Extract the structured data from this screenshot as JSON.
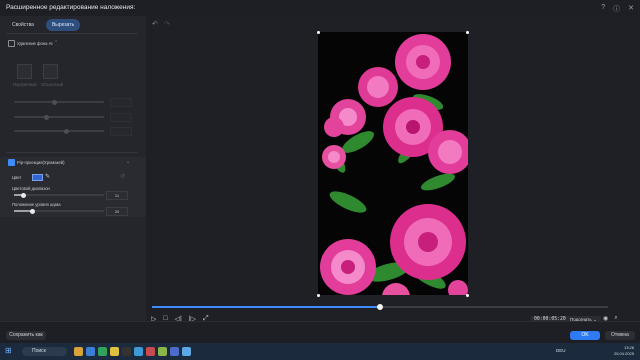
{
  "window": {
    "title": "Расширенное редактирование наложения:"
  },
  "tabs": [
    {
      "label": "Свойства",
      "active": false
    },
    {
      "label": "Вырезать",
      "active": true
    }
  ],
  "ai_removal": {
    "label": "Удаление фона AI",
    "enabled": false,
    "options": [
      "Портретный",
      "Объектный"
    ],
    "rows": [
      "",
      "",
      "",
      "",
      ""
    ]
  },
  "pip": {
    "label": "Pip-проекция(Хромакей)",
    "enabled": true,
    "color_label": "Цвет",
    "color": "#2f66d2",
    "tolerance_label": "Цветовой диапазон",
    "tolerance_value": "11",
    "tolerance_fraction": 0.11,
    "edge_label": "Положение уровня шума",
    "edge_value": "20",
    "edge_fraction": 0.2
  },
  "preview": {
    "timecode": "00:00:05:20",
    "fit_label": "Подогнать",
    "progress": 0.5
  },
  "buttons": {
    "save": "Сохранить как",
    "ok": "OK",
    "cancel": "Отмена"
  },
  "taskbar": {
    "search": "Поиск",
    "lang": "DEU",
    "time": "13:26",
    "date": "25.04.2025"
  },
  "colors": {
    "accent": "#3f8cff",
    "panel": "#24262c",
    "rose": "#e23d9a"
  }
}
